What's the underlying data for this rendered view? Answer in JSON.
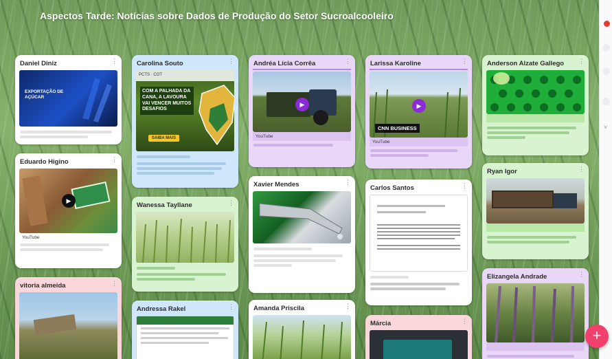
{
  "board": {
    "top_label": "",
    "title": "Aspectos Tarde: Notícias sobre Dados de Produção do Setor Sucroalcooleiro",
    "subtitle": ""
  },
  "cards": {
    "daniel": {
      "author": "Daniel Diniz",
      "media_caption": "EXPORTAÇÃO DE AÇÚCAR"
    },
    "eduardo": {
      "author": "Eduardo Higino",
      "source": "YouTube"
    },
    "vitoria": {
      "author": "vitoria almeida"
    },
    "carolina": {
      "author": "Carolina Souto",
      "media_text_1": "COM A PALHADA DA CANA, A LAVOURA VAI VENCER MUITOS DESAFIOS",
      "media_btn": "SAIBA MAIS",
      "media_logos": "PCTS · COT"
    },
    "wanessa": {
      "author": "Wanessa Tayllane"
    },
    "andressa": {
      "author": "Andressa Rakel"
    },
    "andrea": {
      "author": "Andréa Lícia Corrêa",
      "source": "YouTube"
    },
    "xavier": {
      "author": "Xavier Mendes"
    },
    "amanda": {
      "author": "Amanda Priscila"
    },
    "larissa": {
      "author": "Larissa Karoline",
      "source": "YouTube",
      "overlay": "CNN BUSINESS"
    },
    "carlos": {
      "author": "Carlos Santos"
    },
    "marcia": {
      "author": "Márcia"
    },
    "anderson": {
      "author": "Anderson Alzate Gallego"
    },
    "ryan": {
      "author": "Ryan Igor"
    },
    "elizangela": {
      "author": "Elizangela Andrade"
    }
  },
  "fab": {
    "label": "+"
  },
  "colors": {
    "fab": "#f0406b",
    "play": "#8b2bd6",
    "card_blue": "#cfe7fb",
    "card_purple": "#e9d7f7",
    "card_green": "#d8f3cf",
    "card_pink": "#f9d7db"
  }
}
